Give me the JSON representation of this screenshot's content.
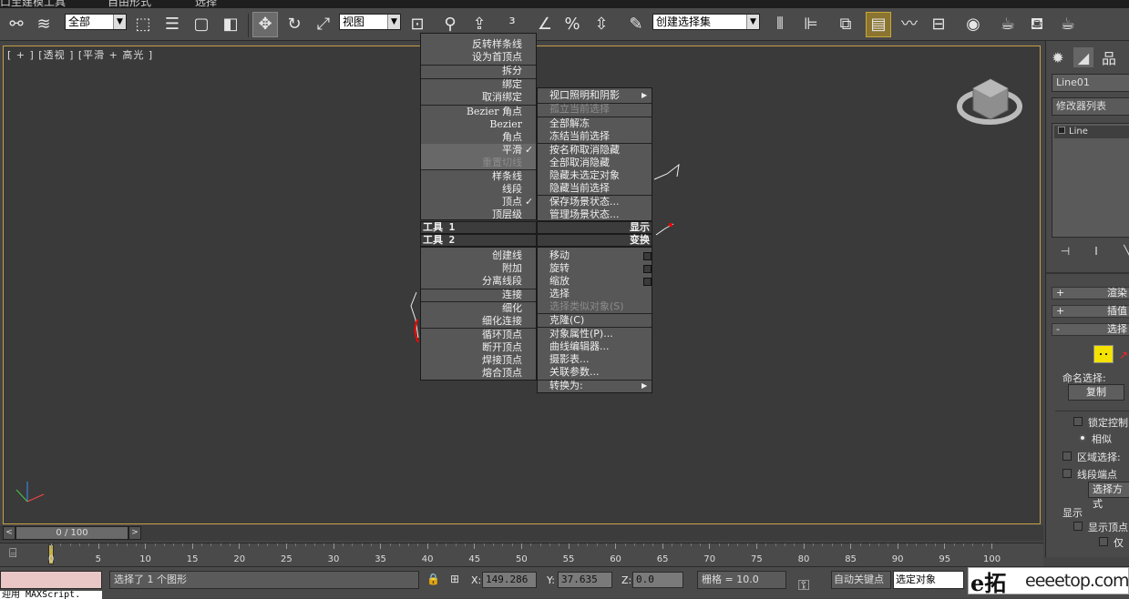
{
  "title_strip": {
    "items": [
      "口至建模工具",
      "自由形式",
      "选择"
    ]
  },
  "toolbar": {
    "selection_filter": "全部",
    "ref_coord": "视图",
    "named_selection": "创建选择集"
  },
  "viewport": {
    "label": "[ + ] [透视 ] [平滑 + 高光 ]"
  },
  "quad_tl": {
    "items": [
      {
        "label": "反转样条线"
      },
      {
        "label": "设为首顶点"
      },
      {
        "label": "拆分"
      },
      {
        "label": "绑定"
      },
      {
        "label": "取消绑定"
      },
      {
        "label": "Bezier 角点"
      },
      {
        "label": "Bezier"
      },
      {
        "label": "角点"
      },
      {
        "label": "平滑",
        "checked": "✓"
      },
      {
        "label": "重置切线"
      },
      {
        "label": "样条线"
      },
      {
        "label": "线段"
      },
      {
        "label": "顶点",
        "checked": "✓"
      },
      {
        "label": "顶层级"
      }
    ],
    "header1": "工具 1",
    "header2": "工具 2"
  },
  "quad_tr": {
    "items": [
      {
        "label": "视口照明和阴影",
        "arrow": "▶"
      },
      {
        "label": "孤立当前选择"
      },
      {
        "label": "全部解冻"
      },
      {
        "label": "冻结当前选择"
      },
      {
        "label": "按名称取消隐藏"
      },
      {
        "label": "全部取消隐藏"
      },
      {
        "label": "隐藏未选定对象"
      },
      {
        "label": "隐藏当前选择"
      },
      {
        "label": "保存场景状态..."
      },
      {
        "label": "管理场景状态..."
      }
    ],
    "header1": "显示",
    "header2": "变换"
  },
  "quad_bl": {
    "items": [
      {
        "label": "创建线"
      },
      {
        "label": "附加"
      },
      {
        "label": "分离线段"
      },
      {
        "label": "连接"
      },
      {
        "label": "细化"
      },
      {
        "label": "细化连接"
      },
      {
        "label": "循环顶点"
      },
      {
        "label": "断开顶点"
      },
      {
        "label": "焊接顶点"
      },
      {
        "label": "熔合顶点"
      }
    ]
  },
  "quad_br": {
    "items": [
      {
        "label": "移动"
      },
      {
        "label": "旋转"
      },
      {
        "label": "缩放"
      },
      {
        "label": "选择"
      },
      {
        "label": "选择类似对象(S)"
      },
      {
        "label": "克隆(C)"
      },
      {
        "label": "对象属性(P)..."
      },
      {
        "label": "曲线编辑器..."
      },
      {
        "label": "摄影表..."
      },
      {
        "label": "关联参数..."
      },
      {
        "label": "转换为:",
        "arrow": "▶"
      }
    ]
  },
  "right_panel": {
    "object_name": "Line01",
    "modifier_list": "修改器列表",
    "stack_item": "Line",
    "rollout_render": "渲染",
    "rollout_interp": "插值",
    "rollout_select": "选择",
    "named_sel_label": "命名选择:",
    "copy_btn": "复制",
    "lock_handles": "锁定控制",
    "similar": "相似",
    "area_select": "区域选择:",
    "segment_end": "线段端点",
    "select_by": "选择方式",
    "display_label": "显示",
    "show_vertex": "显示顶点",
    "only": "仅"
  },
  "timeline": {
    "frame_label": "0 / 100",
    "ticks": [
      "0",
      "5",
      "10",
      "15",
      "20",
      "25",
      "30",
      "35",
      "40",
      "45",
      "50",
      "55",
      "60",
      "65",
      "70",
      "75",
      "80",
      "85",
      "90",
      "95",
      "100"
    ]
  },
  "status": {
    "maxscript_hint": "迎用 MAXScript.",
    "message": "选择了 1 个图形",
    "x_label": "X:",
    "x_val": "149.286",
    "y_label": "Y:",
    "y_val": "37.635",
    "z_label": "Z:",
    "z_val": "0.0",
    "grid": "栅格 = 10.0",
    "auto_key": "自动关键点",
    "selected": "选定对象",
    "watermark": "eeeetop.com",
    "watermark_logo": "e拓"
  }
}
